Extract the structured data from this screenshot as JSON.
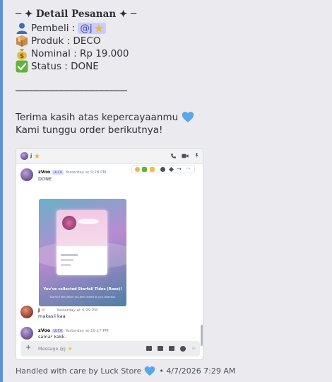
{
  "embed": {
    "title": "─ ✦ Detail Pesanan ✦ ─",
    "buyer_label": "Pembeli :",
    "buyer_mention": "@j",
    "product": "Produk : DECO",
    "amount": "Nominal : Rp 19.000",
    "status": "Status : DONE",
    "divider": "──────────────────────",
    "thanks": "Terima kasih atas kepercayaanmu",
    "awaiting": "Kami tunggu order berikutnya!",
    "footer_text": "Handled with care by Luck Store",
    "footer_timestamp": "• 4/7/2026 7:29 AM",
    "accent_color": "#5f8fd6"
  },
  "screenshot": {
    "channel_name": "j",
    "messages": [
      {
        "author": "zVoo",
        "badge": "LUCK",
        "time": "Yesterday at 9:28 PM",
        "text": "DONE",
        "card": {
          "caption_title": "You've collected Starfall Tides (Rose)!",
          "caption_sub": "Starfall Tides (Rose) has been added to your collection"
        }
      },
      {
        "author": "j",
        "badge": "",
        "time": "Yesterday at 9:29 PM",
        "text": "makasii kaa"
      },
      {
        "author": "zVoo",
        "badge": "LUCK",
        "time": "Yesterday at 10:17 PM",
        "text": "sama² kakk."
      }
    ],
    "input_placeholder": "Message @j"
  }
}
